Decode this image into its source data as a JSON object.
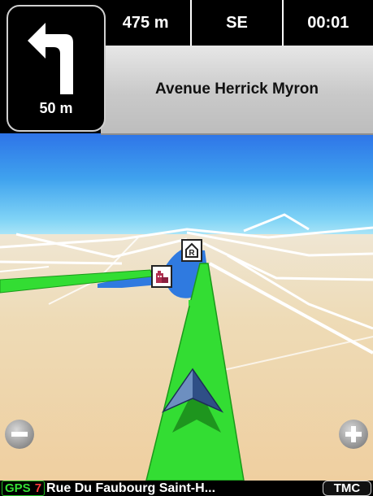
{
  "maneuver": {
    "icon": "turn-left-arrow-icon",
    "distance": "50 m"
  },
  "stats": {
    "distance_remaining": "475 m",
    "heading": "SE",
    "time": "00:01"
  },
  "next_street": "Avenue Herrick Myron",
  "map": {
    "pois": [
      {
        "icon": "restaurant-poi-icon"
      },
      {
        "icon": "hotel-poi-icon"
      }
    ],
    "zoom_out_icon": "minus-icon",
    "zoom_in_icon": "plus-icon",
    "colors": {
      "route": "#33dd33",
      "water": "#2f7ae0",
      "sky": "#3fa2ee",
      "land": "#efd9ab"
    }
  },
  "status": {
    "gps_label": "GPS",
    "satellites": "7",
    "current_street": "Rue Du Faubourg Saint-H...",
    "tmc_label": "TMC"
  }
}
